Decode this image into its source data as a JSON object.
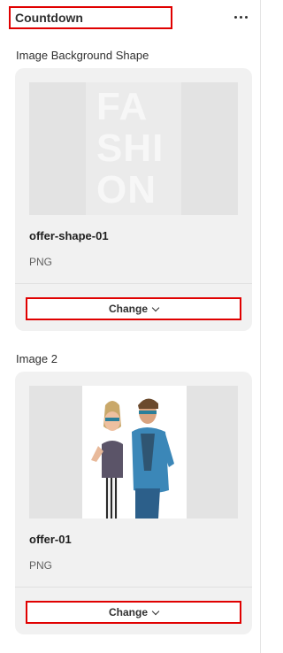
{
  "header": {
    "title": "Countdown"
  },
  "sections": [
    {
      "label": "Image Background Shape",
      "file_name": "offer-shape-01",
      "file_type": "PNG",
      "change_label": "Change",
      "poster_text": [
        "FA",
        "SHI",
        "ON"
      ]
    },
    {
      "label": "Image 2",
      "file_name": "offer-01",
      "file_type": "PNG",
      "change_label": "Change"
    }
  ],
  "colors": {
    "highlight": "#e00000",
    "card_bg": "#f1f1f1",
    "thumb_bg": "#e3e3e3",
    "text": "#303030"
  },
  "icons": {
    "more": "more-horizontal-icon",
    "dropdown": "chevron-down-icon"
  }
}
